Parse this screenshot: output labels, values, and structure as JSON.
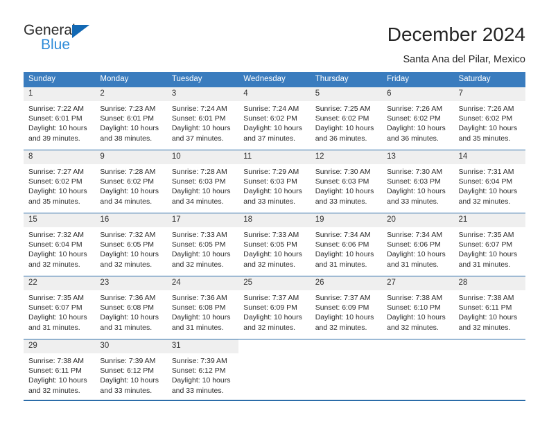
{
  "brand": {
    "name_top": "General",
    "name_bottom": "Blue",
    "triangle_color": "#1268b3",
    "blue_color": "#2e8bd8"
  },
  "header": {
    "title": "December 2024",
    "subtitle": "Santa Ana del Pilar, Mexico"
  },
  "theme": {
    "header_blue": "#3a7cbe",
    "rule_blue": "#2b6ca8",
    "daynum_bg": "#efefef"
  },
  "weekdays": [
    "Sunday",
    "Monday",
    "Tuesday",
    "Wednesday",
    "Thursday",
    "Friday",
    "Saturday"
  ],
  "weeks": [
    [
      {
        "day": "1",
        "sunrise": "Sunrise: 7:22 AM",
        "sunset": "Sunset: 6:01 PM",
        "daylight1": "Daylight: 10 hours",
        "daylight2": "and 39 minutes."
      },
      {
        "day": "2",
        "sunrise": "Sunrise: 7:23 AM",
        "sunset": "Sunset: 6:01 PM",
        "daylight1": "Daylight: 10 hours",
        "daylight2": "and 38 minutes."
      },
      {
        "day": "3",
        "sunrise": "Sunrise: 7:24 AM",
        "sunset": "Sunset: 6:01 PM",
        "daylight1": "Daylight: 10 hours",
        "daylight2": "and 37 minutes."
      },
      {
        "day": "4",
        "sunrise": "Sunrise: 7:24 AM",
        "sunset": "Sunset: 6:02 PM",
        "daylight1": "Daylight: 10 hours",
        "daylight2": "and 37 minutes."
      },
      {
        "day": "5",
        "sunrise": "Sunrise: 7:25 AM",
        "sunset": "Sunset: 6:02 PM",
        "daylight1": "Daylight: 10 hours",
        "daylight2": "and 36 minutes."
      },
      {
        "day": "6",
        "sunrise": "Sunrise: 7:26 AM",
        "sunset": "Sunset: 6:02 PM",
        "daylight1": "Daylight: 10 hours",
        "daylight2": "and 36 minutes."
      },
      {
        "day": "7",
        "sunrise": "Sunrise: 7:26 AM",
        "sunset": "Sunset: 6:02 PM",
        "daylight1": "Daylight: 10 hours",
        "daylight2": "and 35 minutes."
      }
    ],
    [
      {
        "day": "8",
        "sunrise": "Sunrise: 7:27 AM",
        "sunset": "Sunset: 6:02 PM",
        "daylight1": "Daylight: 10 hours",
        "daylight2": "and 35 minutes."
      },
      {
        "day": "9",
        "sunrise": "Sunrise: 7:28 AM",
        "sunset": "Sunset: 6:02 PM",
        "daylight1": "Daylight: 10 hours",
        "daylight2": "and 34 minutes."
      },
      {
        "day": "10",
        "sunrise": "Sunrise: 7:28 AM",
        "sunset": "Sunset: 6:03 PM",
        "daylight1": "Daylight: 10 hours",
        "daylight2": "and 34 minutes."
      },
      {
        "day": "11",
        "sunrise": "Sunrise: 7:29 AM",
        "sunset": "Sunset: 6:03 PM",
        "daylight1": "Daylight: 10 hours",
        "daylight2": "and 33 minutes."
      },
      {
        "day": "12",
        "sunrise": "Sunrise: 7:30 AM",
        "sunset": "Sunset: 6:03 PM",
        "daylight1": "Daylight: 10 hours",
        "daylight2": "and 33 minutes."
      },
      {
        "day": "13",
        "sunrise": "Sunrise: 7:30 AM",
        "sunset": "Sunset: 6:03 PM",
        "daylight1": "Daylight: 10 hours",
        "daylight2": "and 33 minutes."
      },
      {
        "day": "14",
        "sunrise": "Sunrise: 7:31 AM",
        "sunset": "Sunset: 6:04 PM",
        "daylight1": "Daylight: 10 hours",
        "daylight2": "and 32 minutes."
      }
    ],
    [
      {
        "day": "15",
        "sunrise": "Sunrise: 7:32 AM",
        "sunset": "Sunset: 6:04 PM",
        "daylight1": "Daylight: 10 hours",
        "daylight2": "and 32 minutes."
      },
      {
        "day": "16",
        "sunrise": "Sunrise: 7:32 AM",
        "sunset": "Sunset: 6:05 PM",
        "daylight1": "Daylight: 10 hours",
        "daylight2": "and 32 minutes."
      },
      {
        "day": "17",
        "sunrise": "Sunrise: 7:33 AM",
        "sunset": "Sunset: 6:05 PM",
        "daylight1": "Daylight: 10 hours",
        "daylight2": "and 32 minutes."
      },
      {
        "day": "18",
        "sunrise": "Sunrise: 7:33 AM",
        "sunset": "Sunset: 6:05 PM",
        "daylight1": "Daylight: 10 hours",
        "daylight2": "and 32 minutes."
      },
      {
        "day": "19",
        "sunrise": "Sunrise: 7:34 AM",
        "sunset": "Sunset: 6:06 PM",
        "daylight1": "Daylight: 10 hours",
        "daylight2": "and 31 minutes."
      },
      {
        "day": "20",
        "sunrise": "Sunrise: 7:34 AM",
        "sunset": "Sunset: 6:06 PM",
        "daylight1": "Daylight: 10 hours",
        "daylight2": "and 31 minutes."
      },
      {
        "day": "21",
        "sunrise": "Sunrise: 7:35 AM",
        "sunset": "Sunset: 6:07 PM",
        "daylight1": "Daylight: 10 hours",
        "daylight2": "and 31 minutes."
      }
    ],
    [
      {
        "day": "22",
        "sunrise": "Sunrise: 7:35 AM",
        "sunset": "Sunset: 6:07 PM",
        "daylight1": "Daylight: 10 hours",
        "daylight2": "and 31 minutes."
      },
      {
        "day": "23",
        "sunrise": "Sunrise: 7:36 AM",
        "sunset": "Sunset: 6:08 PM",
        "daylight1": "Daylight: 10 hours",
        "daylight2": "and 31 minutes."
      },
      {
        "day": "24",
        "sunrise": "Sunrise: 7:36 AM",
        "sunset": "Sunset: 6:08 PM",
        "daylight1": "Daylight: 10 hours",
        "daylight2": "and 31 minutes."
      },
      {
        "day": "25",
        "sunrise": "Sunrise: 7:37 AM",
        "sunset": "Sunset: 6:09 PM",
        "daylight1": "Daylight: 10 hours",
        "daylight2": "and 32 minutes."
      },
      {
        "day": "26",
        "sunrise": "Sunrise: 7:37 AM",
        "sunset": "Sunset: 6:09 PM",
        "daylight1": "Daylight: 10 hours",
        "daylight2": "and 32 minutes."
      },
      {
        "day": "27",
        "sunrise": "Sunrise: 7:38 AM",
        "sunset": "Sunset: 6:10 PM",
        "daylight1": "Daylight: 10 hours",
        "daylight2": "and 32 minutes."
      },
      {
        "day": "28",
        "sunrise": "Sunrise: 7:38 AM",
        "sunset": "Sunset: 6:11 PM",
        "daylight1": "Daylight: 10 hours",
        "daylight2": "and 32 minutes."
      }
    ],
    [
      {
        "day": "29",
        "sunrise": "Sunrise: 7:38 AM",
        "sunset": "Sunset: 6:11 PM",
        "daylight1": "Daylight: 10 hours",
        "daylight2": "and 32 minutes."
      },
      {
        "day": "30",
        "sunrise": "Sunrise: 7:39 AM",
        "sunset": "Sunset: 6:12 PM",
        "daylight1": "Daylight: 10 hours",
        "daylight2": "and 33 minutes."
      },
      {
        "day": "31",
        "sunrise": "Sunrise: 7:39 AM",
        "sunset": "Sunset: 6:12 PM",
        "daylight1": "Daylight: 10 hours",
        "daylight2": "and 33 minutes."
      },
      {
        "day": "",
        "sunrise": "",
        "sunset": "",
        "daylight1": "",
        "daylight2": ""
      },
      {
        "day": "",
        "sunrise": "",
        "sunset": "",
        "daylight1": "",
        "daylight2": ""
      },
      {
        "day": "",
        "sunrise": "",
        "sunset": "",
        "daylight1": "",
        "daylight2": ""
      },
      {
        "day": "",
        "sunrise": "",
        "sunset": "",
        "daylight1": "",
        "daylight2": ""
      }
    ]
  ]
}
